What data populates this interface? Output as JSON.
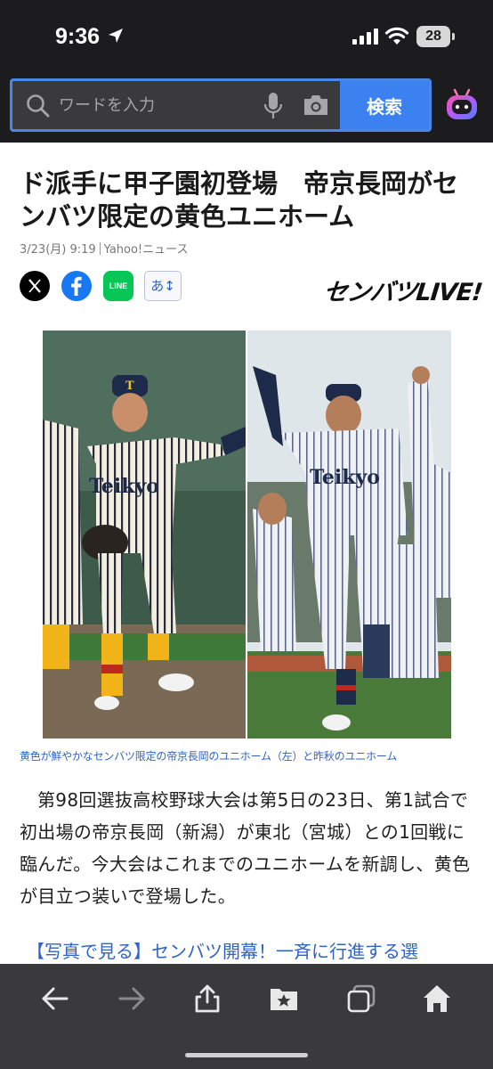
{
  "status_bar": {
    "time": "9:36",
    "battery": "28"
  },
  "search": {
    "placeholder": "ワードを入力",
    "button_label": "検索"
  },
  "article": {
    "headline": "ド派手に甲子園初登場　帝京長岡がセンバツ限定の黄色ユニホーム",
    "date": "3/23(月) 9:19",
    "source": "Yahoo!ニュース",
    "brand_logo": "センバツLIVE!",
    "font_size_button": "あ↕",
    "line_label": "LINE",
    "photo": {
      "left_jersey_text": "Teikyo",
      "right_jersey_text": "Teikyo"
    },
    "caption": "黄色が鮮やかなセンバツ限定の帝京長岡のユニホーム（左）と昨秋のユニホーム",
    "body": "第98回選抜高校野球大会は第5日の23日、第1試合で初出場の帝京長岡（新潟）が東北（宮城）との1回戦に臨んだ。今大会はこれまでのユニホームを新調し、黄色が目立つ装いで登場した。",
    "related_link": "【写真で見る】センバツ開幕！一斉に行進する選"
  },
  "toolbar": {
    "icons": [
      "back-arrow-icon",
      "forward-arrow-icon",
      "share-icon",
      "bookmark-folder-icon",
      "tabs-icon",
      "home-icon"
    ]
  },
  "colors": {
    "header_bg": "#1c1c1e",
    "accent": "#3b82f0",
    "link": "#2f63c6",
    "toolbar_bg": "#3a3a3c"
  }
}
